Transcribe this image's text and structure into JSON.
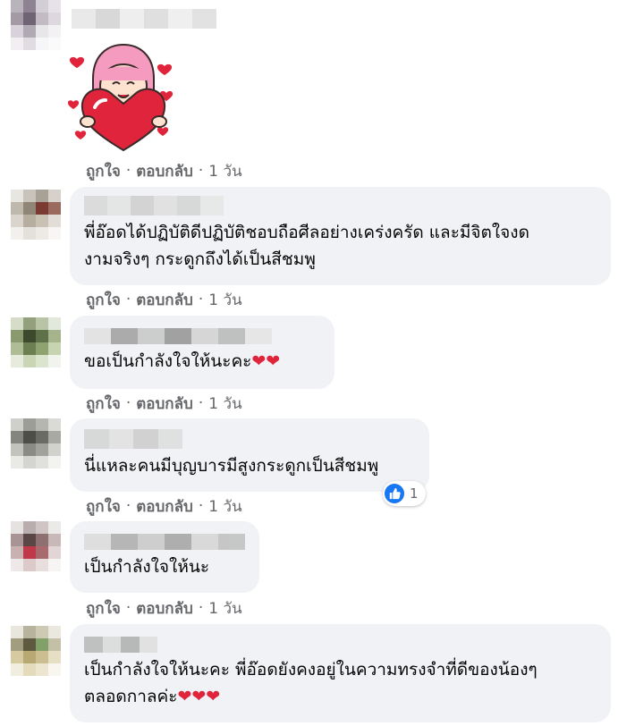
{
  "comments": [
    {
      "text": "",
      "actions": {
        "like": "ถูกใจ",
        "reply": "ตอบกลับ",
        "time": "1 วัน"
      }
    },
    {
      "text": "พี่อ๊อดได้ปฏิบัติดีปฏิบัติชอบถือศีลอย่างเคร่งครัด และมีจิตใจงด\nงามจริงๆ กระดูกถึงได้เป็นสีชมพู",
      "actions": {
        "like": "ถูกใจ",
        "reply": "ตอบกลับ",
        "time": "1 วัน"
      }
    },
    {
      "text": "ขอเป็นกำลังใจให้นะคะ",
      "hearts": "❤❤",
      "actions": {
        "like": "ถูกใจ",
        "reply": "ตอบกลับ",
        "time": "1 วัน"
      }
    },
    {
      "text": "นี่แหละคนมีบุญบารมีสูงกระดูกเป็นสีชมพู",
      "reaction_count": "1",
      "actions": {
        "like": "ถูกใจ",
        "reply": "ตอบกลับ",
        "time": "1 วัน"
      }
    },
    {
      "text": "เป็นกำลังใจให้นะ",
      "actions": {
        "like": "ถูกใจ",
        "reply": "ตอบกลับ",
        "time": "1 วัน"
      }
    },
    {
      "text": "เป็นกำลังใจให้นะคะ พี่อ๊อดยังคงอยู่ในความทรงจำที่ดีของน้องๆ\nตลอดกาลค่ะ",
      "hearts": "❤❤❤"
    }
  ],
  "separator": "·",
  "icons": {
    "like_reaction": "thumbs-up-icon",
    "sticker": "heart-girl-sticker"
  },
  "colors": {
    "bubble": "#f0f2f5",
    "meta": "#65676b",
    "like_blue": "#1877f2",
    "heart": "#e0243b"
  }
}
